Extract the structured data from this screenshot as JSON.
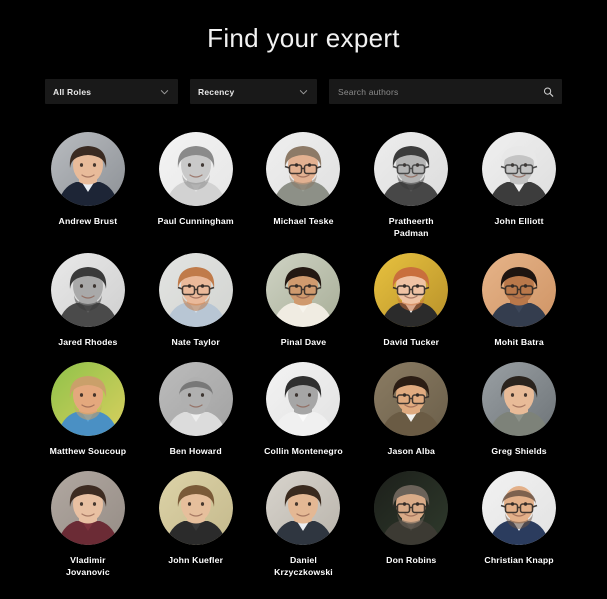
{
  "header": {
    "title": "Find your expert"
  },
  "filters": {
    "role_select": {
      "label": "All Roles",
      "icon": "chevron-down-icon"
    },
    "sort_select": {
      "label": "Recency",
      "icon": "chevron-down-icon"
    },
    "search": {
      "placeholder": "Search authors",
      "value": "",
      "icon": "search-icon"
    }
  },
  "colors": {
    "background": "#000000",
    "control_background": "#191919",
    "text_primary": "#ffffff",
    "text_placeholder": "#8c8c8c",
    "icon_gray": "#9a9a9a"
  },
  "experts": [
    {
      "name": "Andrew Brust",
      "avatar": {
        "bg": "#b9bcc0",
        "bg2": "#8d9196",
        "skin": "#e8bb9a",
        "hair": "#3a2a21",
        "clothes": "#1d2536",
        "shirt": "#e9edf2",
        "glasses": false,
        "beard": false,
        "grayscale": false,
        "bald": false
      }
    },
    {
      "name": "Paul Cunningham",
      "avatar": {
        "bg": "#f4f4f4",
        "bg2": "#e6e6e6",
        "skin": "#c9c9c9",
        "hair": "#8a8a8a",
        "clothes": "#d2d2d2",
        "shirt": "#e2e2e2",
        "glasses": false,
        "beard": true,
        "grayscale": true,
        "bald": false
      }
    },
    {
      "name": "Michael Teske",
      "avatar": {
        "bg": "#efefef",
        "bg2": "#e0e0e0",
        "skin": "#e3b191",
        "hair": "#8d7a67",
        "clothes": "#8d9087",
        "shirt": "#9a9d94",
        "glasses": true,
        "beard": true,
        "grayscale": false,
        "bald": false
      }
    },
    {
      "name": "Pratheerth Padman",
      "avatar": {
        "bg": "#ededed",
        "bg2": "#dcdcdc",
        "skin": "#b4b4b4",
        "hair": "#3b3b3b",
        "clothes": "#474747",
        "shirt": "#555555",
        "glasses": true,
        "beard": true,
        "grayscale": true,
        "bald": false
      }
    },
    {
      "name": "John Elliott",
      "avatar": {
        "bg": "#f0f0f0",
        "bg2": "#dedede",
        "skin": "#c4c4c4",
        "hair": "#e8e8e8",
        "clothes": "#3c3c3c",
        "shirt": "#efefef",
        "glasses": true,
        "beard": false,
        "grayscale": true,
        "bald": false
      }
    },
    {
      "name": "Jared Rhodes",
      "avatar": {
        "bg": "#e9e9e9",
        "bg2": "#cfcfcf",
        "skin": "#a9a9a9",
        "hair": "#3a3a3a",
        "clothes": "#4a4a4a",
        "shirt": "#5c5c5c",
        "glasses": false,
        "beard": true,
        "grayscale": true,
        "bald": false
      }
    },
    {
      "name": "Nate Taylor",
      "avatar": {
        "bg": "#e3e4e2",
        "bg2": "#d2d4d1",
        "skin": "#eab99a",
        "hair": "#c07b4a",
        "clothes": "#b8c6d4",
        "shirt": "#d4dde6",
        "glasses": true,
        "beard": true,
        "grayscale": false,
        "bald": false
      }
    },
    {
      "name": "Pinal Dave",
      "avatar": {
        "bg": "#cfd3c4",
        "bg2": "#a8ae98",
        "skin": "#cf9a6e",
        "hair": "#231812",
        "clothes": "#f0ece2",
        "shirt": "#f6f4ec",
        "glasses": true,
        "beard": false,
        "grayscale": false,
        "bald": false
      }
    },
    {
      "name": "David Tucker",
      "avatar": {
        "bg": "#e8c23f",
        "bg2": "#b8912a",
        "skin": "#f0c3a4",
        "hair": "#c96f3c",
        "clothes": "#2b2b2b",
        "shirt": "#efefef",
        "glasses": true,
        "beard": true,
        "grayscale": false,
        "bald": false
      }
    },
    {
      "name": "Mohit Batra",
      "avatar": {
        "bg": "#e6b489",
        "bg2": "#cf9465",
        "skin": "#b9784a",
        "hair": "#1d1410",
        "clothes": "#343d4e",
        "shirt": "#3d475a",
        "glasses": true,
        "beard": false,
        "grayscale": false,
        "bald": false
      }
    },
    {
      "name": "Matthew Soucoup",
      "avatar": {
        "bg": "#8fc24a",
        "bg2": "#d9cf5e",
        "skin": "#e4a87d",
        "hair": "#caa06a",
        "clothes": "#4a90c4",
        "shirt": "#5ba3d6",
        "glasses": false,
        "beard": true,
        "grayscale": false,
        "bald": false
      }
    },
    {
      "name": "Ben Howard",
      "avatar": {
        "bg": "#bcbcbc",
        "bg2": "#a2a2a2",
        "skin": "#b0b0b0",
        "hair": "#6e6e6e",
        "clothes": "#dcdcdc",
        "shirt": "#ededed",
        "glasses": false,
        "beard": false,
        "grayscale": true,
        "bald": true
      }
    },
    {
      "name": "Collin Montenegro",
      "avatar": {
        "bg": "#f3f3f3",
        "bg2": "#e2e2e2",
        "skin": "#a6a6a6",
        "hair": "#2f2f2f",
        "clothes": "#f0f0f0",
        "shirt": "#fafafa",
        "glasses": false,
        "beard": false,
        "grayscale": true,
        "bald": false
      }
    },
    {
      "name": "Jason Alba",
      "avatar": {
        "bg": "#8b7c63",
        "bg2": "#6b5f4a",
        "skin": "#e0ab80",
        "hair": "#2b1d14",
        "clothes": "#6a5b44",
        "shirt": "#f4f2ee",
        "glasses": true,
        "beard": false,
        "grayscale": false,
        "bald": false
      }
    },
    {
      "name": "Greg Shields",
      "avatar": {
        "bg": "#9aa0a4",
        "bg2": "#6e7478",
        "skin": "#e8bb98",
        "hair": "#2a231d",
        "clothes": "#7d8279",
        "shirt": "#8d9289",
        "glasses": false,
        "beard": false,
        "grayscale": false,
        "bald": false
      }
    },
    {
      "name": "Vladimir Jovanovic",
      "avatar": {
        "bg": "#b1a8a1",
        "bg2": "#968d86",
        "skin": "#e8c0a2",
        "hair": "#3d2b21",
        "clothes": "#6b2b35",
        "shirt": "#7d323d",
        "glasses": false,
        "beard": false,
        "grayscale": false,
        "bald": false
      }
    },
    {
      "name": "John Kuefler",
      "avatar": {
        "bg": "#ddd3a8",
        "bg2": "#c4b98c",
        "skin": "#e6bf9c",
        "hair": "#7a5a38",
        "clothes": "#2b2b2b",
        "shirt": "#383838",
        "glasses": false,
        "beard": false,
        "grayscale": false,
        "bald": false
      }
    },
    {
      "name": "Daniel Krzyczkowski",
      "avatar": {
        "bg": "#d8d4cd",
        "bg2": "#b9b4ab",
        "skin": "#e4b894",
        "hair": "#3a2a1e",
        "clothes": "#2f3640",
        "shirt": "#ebeef2",
        "glasses": false,
        "beard": false,
        "grayscale": false,
        "bald": false
      }
    },
    {
      "name": "Don Robins",
      "avatar": {
        "bg": "#1c1f1a",
        "bg2": "#2f3a2c",
        "skin": "#d9ab88",
        "hair": "#6b6259",
        "clothes": "#3c3a33",
        "shirt": "#4a4840",
        "glasses": true,
        "beard": true,
        "grayscale": false,
        "bald": false
      }
    },
    {
      "name": "Christian Knapp",
      "avatar": {
        "bg": "#f2f2f2",
        "bg2": "#e2e2e2",
        "skin": "#e3b089",
        "hair": "#6b5444",
        "clothes": "#2b3c5e",
        "shirt": "#eef1f5",
        "glasses": true,
        "beard": true,
        "grayscale": false,
        "bald": true
      }
    }
  ]
}
